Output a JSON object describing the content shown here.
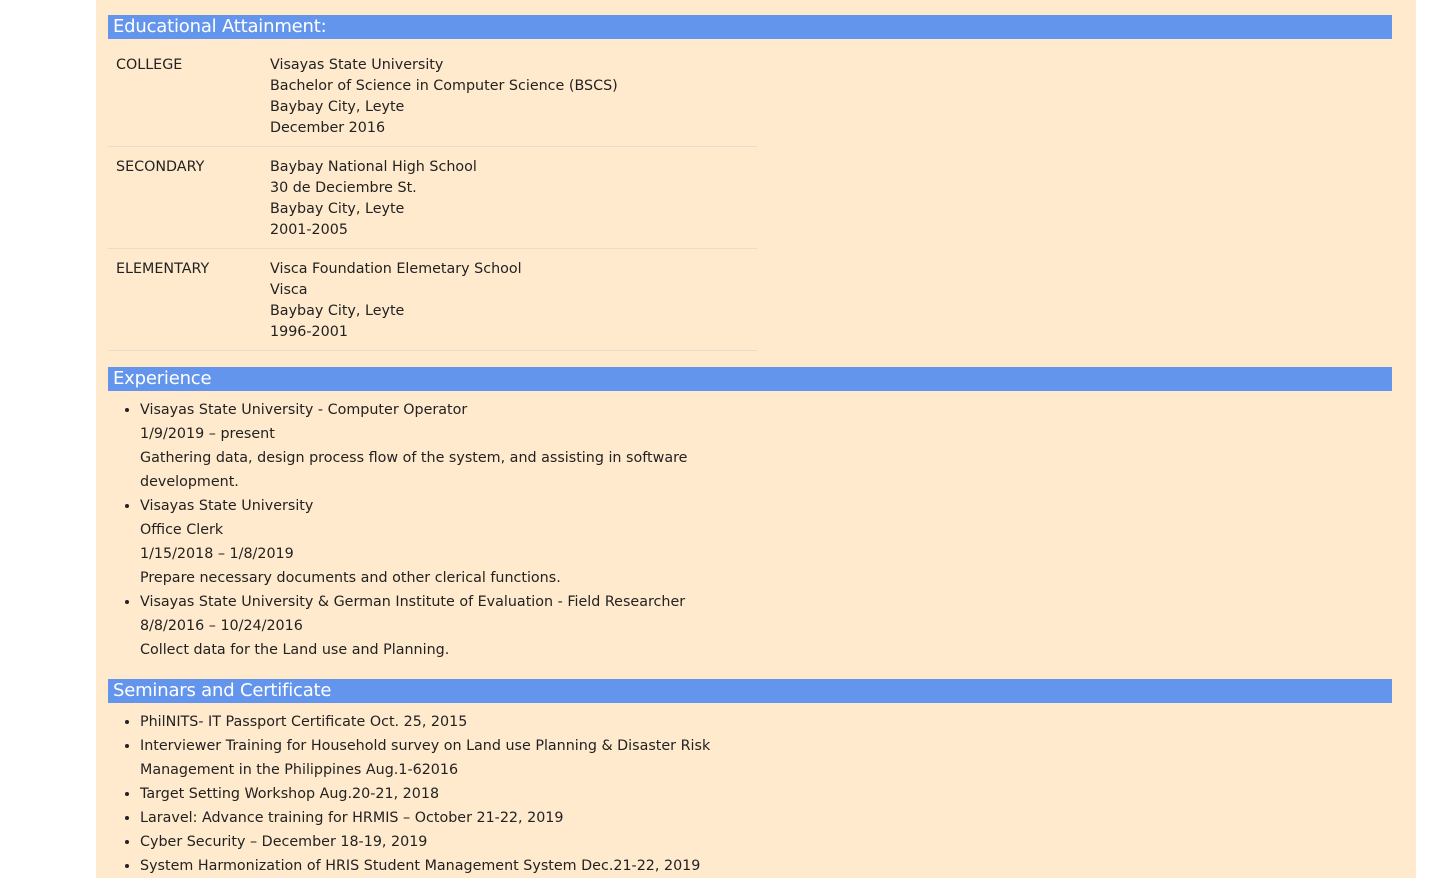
{
  "education": {
    "title": "Educational Attainment:",
    "rows": [
      {
        "level": "COLLEGE",
        "lines": [
          "Visayas State University",
          "Bachelor of Science in Computer Science (BSCS)",
          "Baybay City, Leyte",
          "December 2016"
        ]
      },
      {
        "level": "SECONDARY",
        "lines": [
          "Baybay National High School",
          "30 de Deciembre St.",
          "Baybay City, Leyte",
          "2001-2005"
        ]
      },
      {
        "level": "ELEMENTARY",
        "lines": [
          "Visca Foundation Elemetary School",
          "Visca",
          "Baybay City, Leyte",
          "1996-2001"
        ]
      }
    ]
  },
  "experience": {
    "title": "Experience",
    "items": [
      {
        "lines": [
          "Visayas State University - Computer Operator",
          "1/9/2019 – present",
          "Gathering data, design process flow of the system, and assisting in software development."
        ]
      },
      {
        "lines": [
          "Visayas State University",
          "Office Clerk",
          "1/15/2018 – 1/8/2019",
          "Prepare necessary documents and other clerical functions."
        ]
      },
      {
        "lines": [
          "Visayas State University & German Institute of Evaluation - Field Researcher",
          "8/8/2016 – 10/24/2016",
          "Collect data for the Land use and Planning."
        ]
      }
    ]
  },
  "seminars": {
    "title": "Seminars and Certificate",
    "items": [
      "PhilNITS- IT Passport Certificate Oct. 25, 2015",
      "Interviewer Training for Household survey on Land use Planning & Disaster Risk Management in the Philippines Aug.1-62016",
      "Target Setting Workshop Aug.20-21, 2018",
      "Laravel: Advance training for HRMIS – October 21-22, 2019",
      "Cyber Security – December 18-19, 2019",
      "System Harmonization of HRIS Student Management System Dec.21-22, 2019"
    ]
  },
  "colors": {
    "background": "#ffeacd",
    "header": "#6495ed"
  }
}
